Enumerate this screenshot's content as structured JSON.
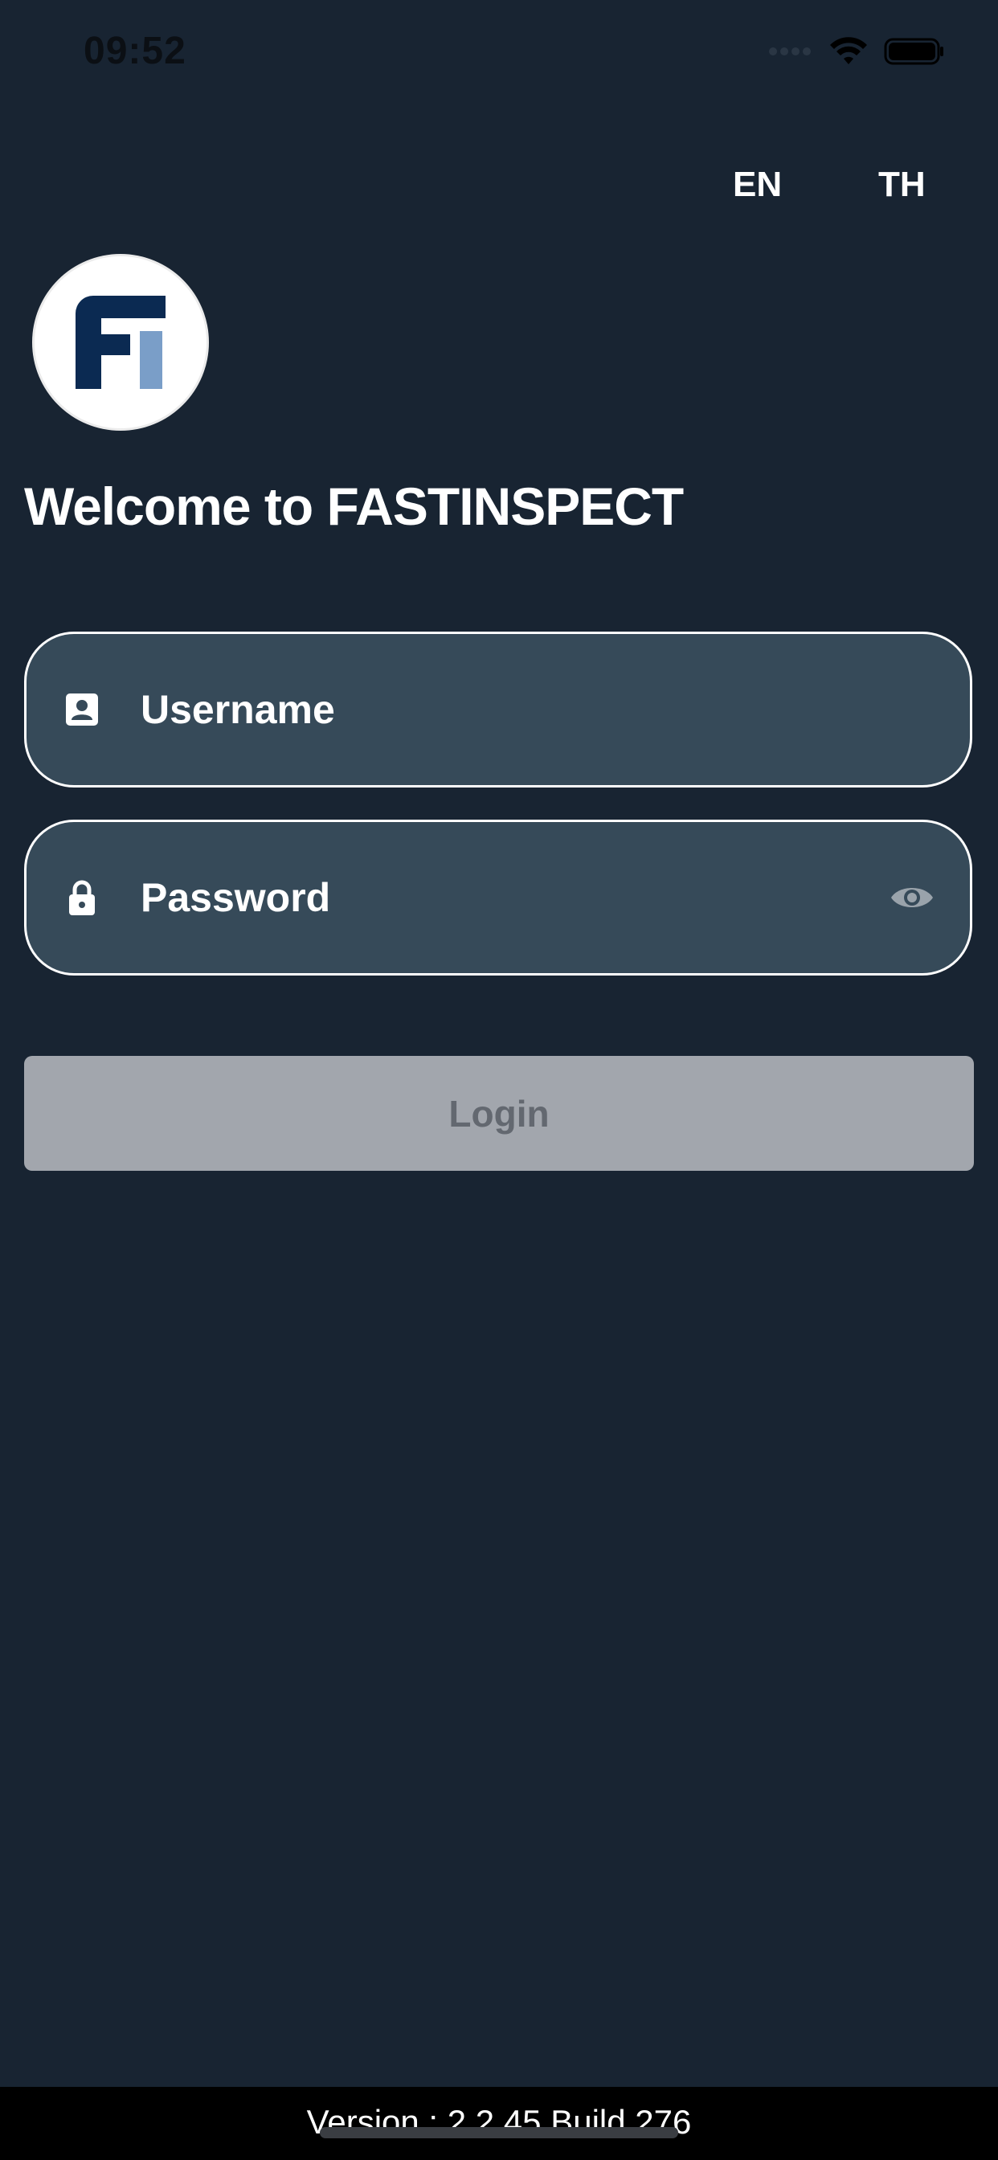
{
  "status_bar": {
    "time": "09:52",
    "icons": [
      "signal-dots-icon",
      "wifi-icon",
      "battery-icon"
    ]
  },
  "language": {
    "en_label": "EN",
    "th_label": "TH"
  },
  "logo": {
    "alt": "FI",
    "colors": {
      "dark": "#0b2a52",
      "light": "#7a9ec8"
    }
  },
  "welcome": {
    "title": "Welcome to FASTINSPECT"
  },
  "form": {
    "username_placeholder": "Username",
    "username_value": "",
    "username_icon": "contact-card-icon",
    "password_placeholder": "Password",
    "password_value": "",
    "password_icon": "lock-icon",
    "visibility_icon": "eye-icon",
    "login_label": "Login"
  },
  "footer": {
    "version": "Version : 2.2.45 Build 276"
  },
  "colors": {
    "background": "#182432",
    "field_background": "#364a59",
    "login_disabled": "#a2a6ad",
    "login_text": "#636870"
  }
}
